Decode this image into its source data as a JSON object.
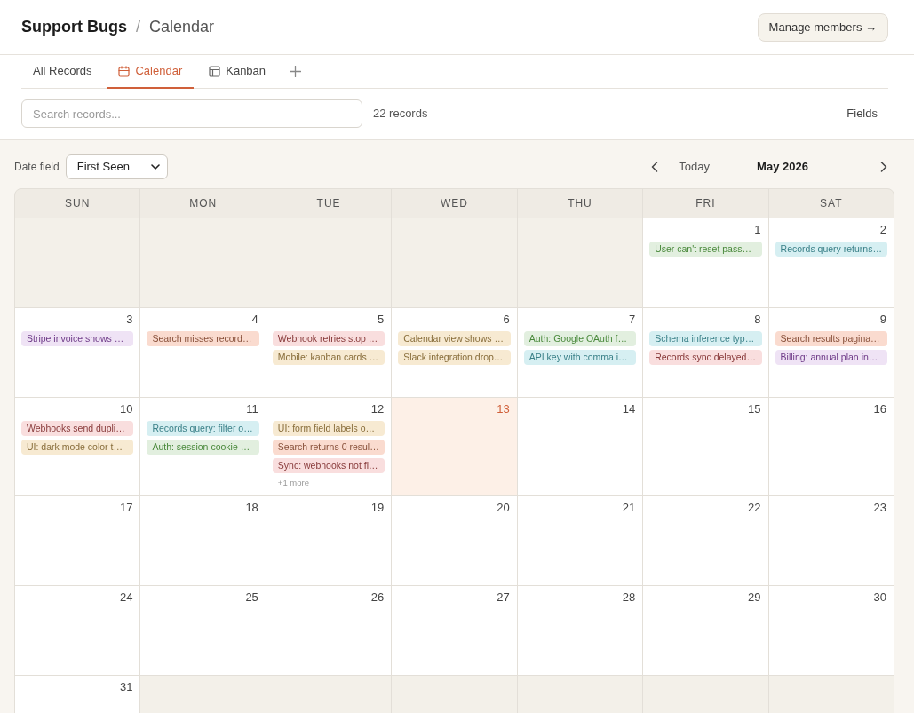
{
  "header": {
    "breadcrumb": [
      "Support Bugs",
      "Calendar"
    ],
    "separator": "/",
    "action": "Manage members →"
  },
  "tabs": [
    {
      "label": "All Records",
      "kind": "grid",
      "selected": false
    },
    {
      "label": "Calendar",
      "kind": "calendar",
      "selected": true
    },
    {
      "label": "Kanban",
      "kind": "kanban",
      "selected": false
    }
  ],
  "toolbar": {
    "search": {
      "placeholder": "Search records..."
    },
    "count": "22 records",
    "fields_button": "Fields"
  },
  "calendar_controls": {
    "date_field_label": "Date field",
    "date_field_value": "First Seen",
    "today_button": "Today",
    "month": "May 2026"
  },
  "calendar": {
    "weekdays": [
      "SUN",
      "MON",
      "TUE",
      "WED",
      "THU",
      "FRI",
      "SAT"
    ],
    "weeks": [
      [
        {
          "kind": "blank"
        },
        {
          "kind": "blank"
        },
        {
          "kind": "blank"
        },
        {
          "kind": "blank"
        },
        {
          "kind": "blank"
        },
        {
          "kind": "day",
          "date": "1",
          "today": false,
          "events": [
            {
              "title": "User can't reset pass…",
              "color": "#e2efdf"
            }
          ]
        },
        {
          "kind": "day",
          "date": "2",
          "today": false,
          "events": [
            {
              "title": "Records query returns…",
              "color": "#d6eff2"
            }
          ]
        }
      ],
      [
        {
          "kind": "day",
          "date": "3",
          "today": false,
          "events": [
            {
              "title": "Stripe invoice shows …",
              "color": "#efe3f5"
            }
          ]
        },
        {
          "kind": "day",
          "date": "4",
          "today": false,
          "events": [
            {
              "title": "Search misses record…",
              "color": "#fadbcf"
            }
          ]
        },
        {
          "kind": "day",
          "date": "5",
          "today": false,
          "events": [
            {
              "title": "Webhook retries stop …",
              "color": "#f9dede"
            },
            {
              "title": "Mobile: kanban cards …",
              "color": "#f7ead2"
            }
          ]
        },
        {
          "kind": "day",
          "date": "6",
          "today": false,
          "events": [
            {
              "title": "Calendar view shows …",
              "color": "#f7ead2"
            },
            {
              "title": "Slack integration drop…",
              "color": "#f7ead2"
            }
          ]
        },
        {
          "kind": "day",
          "date": "7",
          "today": false,
          "events": [
            {
              "title": "Auth: Google OAuth f…",
              "color": "#e2efdf"
            },
            {
              "title": "API key with comma i…",
              "color": "#d6eff2"
            }
          ]
        },
        {
          "kind": "day",
          "date": "8",
          "today": false,
          "events": [
            {
              "title": "Schema inference typ…",
              "color": "#d6eff2"
            },
            {
              "title": "Records sync delayed…",
              "color": "#f9dede"
            }
          ]
        },
        {
          "kind": "day",
          "date": "9",
          "today": false,
          "events": [
            {
              "title": "Search results pagina…",
              "color": "#fadbcf"
            },
            {
              "title": "Billing: annual plan in…",
              "color": "#efe3f5"
            }
          ]
        }
      ],
      [
        {
          "kind": "day",
          "date": "10",
          "today": false,
          "events": [
            {
              "title": "Webhooks send dupli…",
              "color": "#f9dede"
            },
            {
              "title": "UI: dark mode color t…",
              "color": "#f7ead2"
            }
          ]
        },
        {
          "kind": "day",
          "date": "11",
          "today": false,
          "events": [
            {
              "title": "Records query: filter o…",
              "color": "#d6eff2"
            },
            {
              "title": "Auth: session cookie …",
              "color": "#e2efdf"
            }
          ]
        },
        {
          "kind": "day",
          "date": "12",
          "today": false,
          "events": [
            {
              "title": "UI: form field labels o…",
              "color": "#f7ead2"
            },
            {
              "title": "Search returns 0 resul…",
              "color": "#fadbcf"
            },
            {
              "title": "Sync: webhooks not fi…",
              "color": "#f9dede"
            }
          ],
          "more": "+1 more"
        },
        {
          "kind": "day",
          "date": "13",
          "today": true
        },
        {
          "kind": "day",
          "date": "14",
          "today": false
        },
        {
          "kind": "day",
          "date": "15",
          "today": false
        },
        {
          "kind": "day",
          "date": "16",
          "today": false
        }
      ],
      [
        {
          "kind": "day",
          "date": "17",
          "today": false
        },
        {
          "kind": "day",
          "date": "18",
          "today": false
        },
        {
          "kind": "day",
          "date": "19",
          "today": false
        },
        {
          "kind": "day",
          "date": "20",
          "today": false
        },
        {
          "kind": "day",
          "date": "21",
          "today": false
        },
        {
          "kind": "day",
          "date": "22",
          "today": false
        },
        {
          "kind": "day",
          "date": "23",
          "today": false
        }
      ],
      [
        {
          "kind": "day",
          "date": "24",
          "today": false
        },
        {
          "kind": "day",
          "date": "25",
          "today": false
        },
        {
          "kind": "day",
          "date": "26",
          "today": false
        },
        {
          "kind": "day",
          "date": "27",
          "today": false
        },
        {
          "kind": "day",
          "date": "28",
          "today": false
        },
        {
          "kind": "day",
          "date": "29",
          "today": false
        },
        {
          "kind": "day",
          "date": "30",
          "today": false
        }
      ],
      [
        {
          "kind": "day",
          "date": "31",
          "today": false
        },
        {
          "kind": "blank"
        },
        {
          "kind": "blank"
        },
        {
          "kind": "blank"
        },
        {
          "kind": "blank"
        },
        {
          "kind": "blank"
        },
        {
          "kind": "blank"
        }
      ]
    ]
  }
}
